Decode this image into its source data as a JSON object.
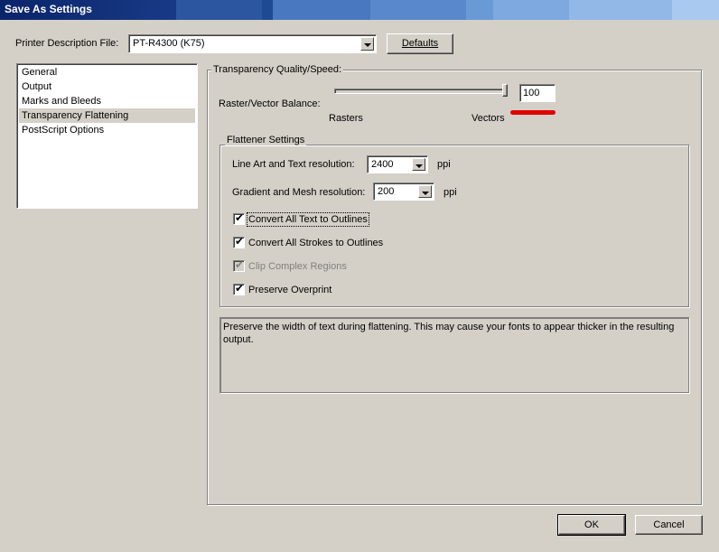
{
  "window": {
    "title": "Save As Settings"
  },
  "ppd": {
    "label": "Printer Description File:",
    "value": "PT-R4300 (K75)",
    "defaults_button": "Defaults"
  },
  "sidebar": {
    "items": [
      {
        "label": "General"
      },
      {
        "label": "Output"
      },
      {
        "label": "Marks and Bleeds"
      },
      {
        "label": "Transparency Flattening"
      },
      {
        "label": "PostScript Options"
      }
    ],
    "selected": "Transparency Flattening"
  },
  "transparency": {
    "group_label": "Transparency Quality/Speed:",
    "balance_label": "Raster/Vector Balance:",
    "balance_value": "100",
    "balance_level": 1.0,
    "left_label": "Rasters",
    "right_label": "Vectors"
  },
  "flattener": {
    "group_label": "Flattener Settings",
    "line_art_label": "Line Art and Text resolution:",
    "line_art_value": "2400",
    "line_art_unit": "ppi",
    "gradient_label": "Gradient and Mesh resolution:",
    "gradient_value": "200",
    "gradient_unit": "ppi",
    "checkboxes": [
      {
        "label": "Convert All Text to Outlines",
        "checked": true,
        "enabled": true
      },
      {
        "label": "Convert All Strokes to Outlines",
        "checked": true,
        "enabled": true
      },
      {
        "label": "Clip Complex Regions",
        "checked": true,
        "enabled": false
      },
      {
        "label": "Preserve Overprint",
        "checked": true,
        "enabled": true
      }
    ]
  },
  "description": {
    "text": "Preserve the width of text during flattening. This may cause your fonts to appear thicker in the resulting output."
  },
  "footer": {
    "ok": "OK",
    "cancel": "Cancel"
  },
  "colors": {
    "annotation": "#e00000",
    "dialog_bg": "#d4d0c8",
    "titlebar": "#0a246a"
  }
}
